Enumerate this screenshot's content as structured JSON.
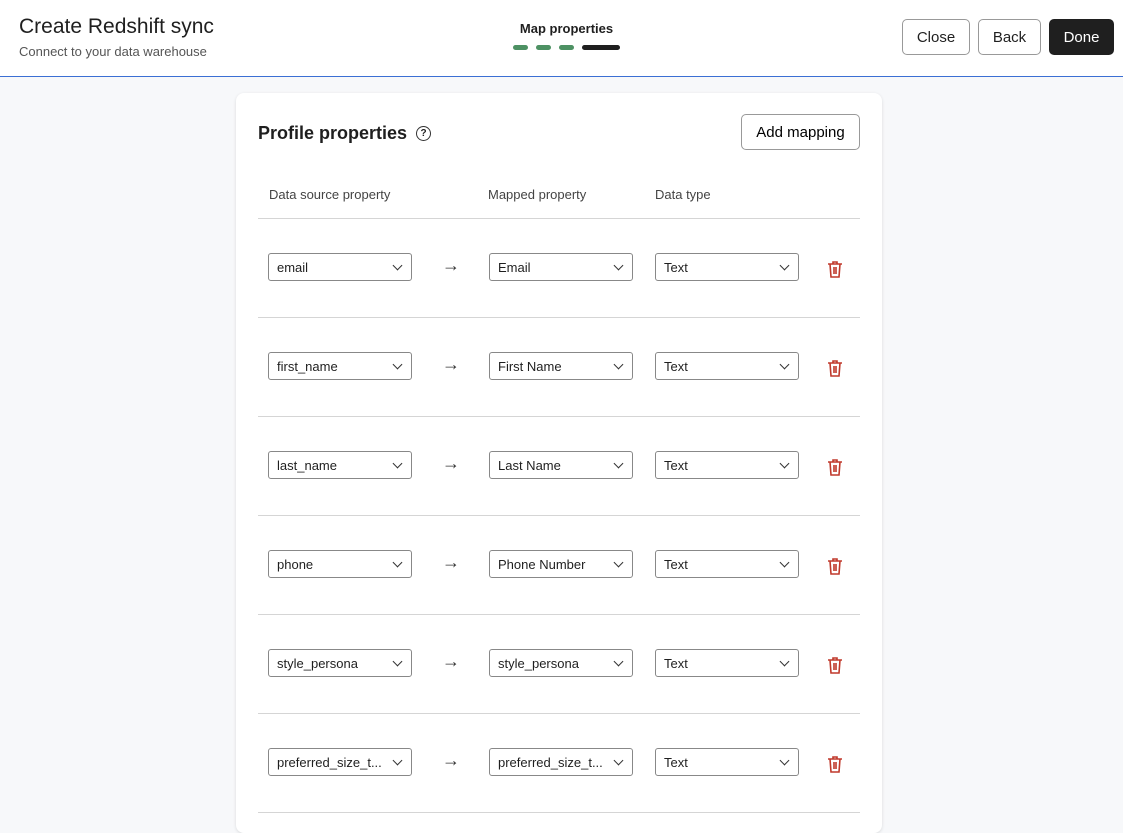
{
  "header": {
    "title": "Create Redshift sync",
    "subtitle": "Connect to your data warehouse",
    "step_label": "Map properties",
    "steps_total": 4,
    "current_step": 4,
    "close": "Close",
    "back": "Back",
    "done": "Done"
  },
  "card": {
    "title": "Profile properties",
    "help": "?",
    "add_mapping": "Add mapping",
    "columns": [
      "Data source property",
      "Mapped property",
      "Data type"
    ],
    "rows": [
      {
        "source": "email",
        "mapped": "Email",
        "type": "Text"
      },
      {
        "source": "first_name",
        "mapped": "First Name",
        "type": "Text"
      },
      {
        "source": "last_name",
        "mapped": "Last Name",
        "type": "Text"
      },
      {
        "source": "phone",
        "mapped": "Phone Number",
        "type": "Text"
      },
      {
        "source": "style_persona",
        "mapped": "style_persona",
        "type": "Text"
      },
      {
        "source": "preferred_size_t...",
        "mapped": "preferred_size_t...",
        "type": "Text"
      }
    ]
  },
  "colors": {
    "accent": "#3b6fd4",
    "step_done": "#4d9163",
    "delete": "#c0392b"
  }
}
